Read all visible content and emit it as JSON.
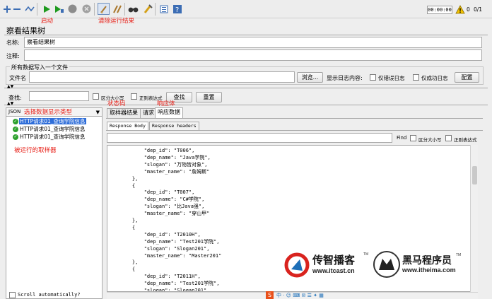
{
  "toolbar": {
    "timer": "00:00:00",
    "warning_count": "0",
    "thread_count": "0/1",
    "icons": [
      "expand-icon",
      "collapse-icon",
      "toggle-icon",
      "start-icon",
      "start-no-pause-icon",
      "stop-icon",
      "shutdown-icon",
      "clear-icon",
      "clear-all-icon",
      "search-icon",
      "reset-search-icon",
      "function-helper-icon",
      "help-icon",
      "warning-icon"
    ]
  },
  "annotations": {
    "start": "启动",
    "clear_results": "清除运行结果",
    "select_display_type": "选择数据显示类型",
    "status_code": "状态码",
    "response_body": "响应体",
    "executed_samplers": "被运行的取样器"
  },
  "panel": {
    "title": "察看结果树",
    "name_label": "名称:",
    "name_value": "察看结果树",
    "comment_label": "注释:",
    "comment_value": ""
  },
  "file_section": {
    "title": "所有数据写入一个文件",
    "filename_label": "文件名",
    "filename_value": "",
    "browse_button": "浏览...",
    "log_content_label": "显示日志内容:",
    "errors_only_label": "仅错误日志",
    "success_only_label": "仅成功日志",
    "configure_button": "配置"
  },
  "search": {
    "label": "查找:",
    "value": "",
    "case_sensitive_label": "区分大小写",
    "regex_label": "正则表达式",
    "search_button": "查找",
    "reset_button": "重置"
  },
  "renderer": {
    "selected": "JSON"
  },
  "tree": {
    "items": [
      {
        "label": "HTTP请求01_查询学院信息",
        "selected": true
      },
      {
        "label": "HTTP请求01_查询学院信息",
        "selected": false
      },
      {
        "label": "HTTP请求01_查询学院信息",
        "selected": false
      }
    ],
    "scroll_auto_label": "Scroll automatically?"
  },
  "result_tabs": [
    "取样器结果",
    "请求",
    "响应数据"
  ],
  "response_tabs": [
    "Response Body",
    "Response headers"
  ],
  "response_find": {
    "find_label": "Find",
    "case_label": "区分大小写",
    "regex_label": "正则表达式"
  },
  "response_lines": [
    "        \"dep_id\": \"T006\",",
    "        \"dep_name\": \"Java学院\",",
    "        \"slogan\": \"万物皆对象\",",
    "        \"master_name\": \"詹姆斯\"",
    "    },",
    "    {",
    "        \"dep_id\": \"T007\",",
    "        \"dep_name\": \"C#学院\",",
    "        \"slogan\": \"比Java强\",",
    "        \"master_name\": \"穿山甲\"",
    "    },",
    "    {",
    "        \"dep_id\": \"T2010H\",",
    "        \"dep_name\": \"Test201学院\",",
    "        \"slogan\": \"Slogan201\",",
    "        \"master_name\": \"Master201\"",
    "    },",
    "    {",
    "        \"dep_id\": \"T2011H\",",
    "        \"dep_name\": \"Test201学院\",",
    "        \"slogan\": \"Slogan201\","
  ],
  "watermarks": {
    "brand1_name": "传智播客",
    "brand1_url": "www.itcast.cn",
    "brand2_name": "黑马程序员",
    "brand2_url": "www.itheima.com",
    "tm": "TM"
  },
  "colors": {
    "annotation": "#e8221a",
    "selection": "#2f6ed9",
    "success": "#2ca02c",
    "brand_red": "#d9231e",
    "brand_blue": "#1d6fb8"
  }
}
